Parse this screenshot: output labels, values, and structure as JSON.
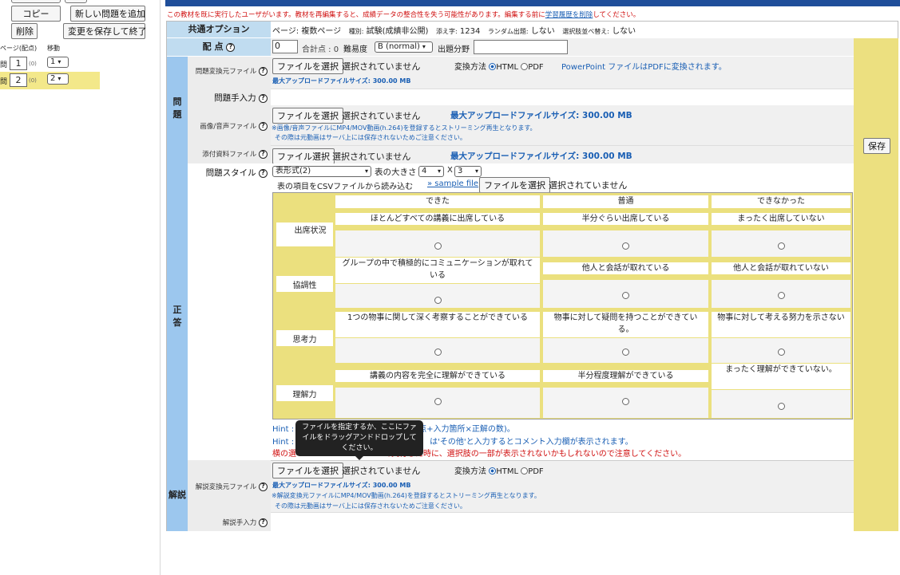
{
  "sidebar": {
    "copy_label": "コピー",
    "add_label": "新しい問題を追加",
    "delete_label": "削除",
    "save_exit_label": "変更を保存して終了",
    "col_page": "ページ(配点)",
    "col_move": "移動",
    "questions": [
      {
        "prefix": "問",
        "num": "1",
        "score": "(0)",
        "move": "1"
      },
      {
        "prefix": "問",
        "num": "2",
        "score": "(0)",
        "move": "2"
      }
    ]
  },
  "warning": {
    "text": "この教材を既に実行したユーザがいます。教材を再編集すると、成績データの整合性を失う可能性があります。編集する前に",
    "link": "学習履歴を削除",
    "after": "してください。"
  },
  "common": {
    "header": "共通オプション",
    "page_label": "ページ:",
    "page_value": "複数ページ",
    "kind_label": "種別:",
    "kind_value": "試験(成績非公開)",
    "chars_label": "添え字:",
    "chars_value": "1234",
    "random_label": "ランダム出題:",
    "random_value": "しない",
    "shuffle_label": "選択肢並べ替え:",
    "shuffle_value": "しない"
  },
  "score_row": {
    "label": "配 点",
    "value": "0",
    "total": "合計点 : 0",
    "difficulty_label": "難易度",
    "difficulty_value": "B (normal)",
    "field_label": "出題分野"
  },
  "question": {
    "section": [
      "問",
      "題"
    ],
    "convert_label": "問題変換元ファイル",
    "file_btn": "ファイルを選択",
    "no_file": "選択されていません",
    "method_label": "変換方法",
    "html": "HTML",
    "pdf": "PDF",
    "ppt_note": "PowerPoint ファイルはPDFに変換されます。",
    "max_upload": "最大アップロードファイルサイズ: 300.00 MB",
    "manual_label": "問題手入力",
    "media_label": "画像/音声ファイル",
    "media_max": "最大アップロードファイルサイズ: 300.00 MB",
    "media_note1": "※画像/音声ファイルにMP4/MOV動画(h.264)を登録するとストリーミング再生となります。",
    "media_note2": "その際は元動画はサーバ上には保存されないためご注意ください。",
    "attach_label": "添付資料ファイル",
    "attach_btn": "ファイル選択",
    "attach_max": "最大アップロードファイルサイズ: 300.00 MB"
  },
  "answer": {
    "section": [
      "正",
      "答"
    ],
    "style_label": "問題スタイル",
    "style_value": "表形式(2)",
    "size_label": "表の大きさ",
    "size_rows": "4",
    "size_x": "X",
    "size_cols": "3",
    "csv_label": "表の項目をCSVファイルから読み込む",
    "sample_link": "» sample file",
    "file_btn": "ファイルを選択",
    "no_file": "選択されていません",
    "grid": {
      "columns": [
        "できた",
        "普通",
        "できなかった"
      ],
      "rows": [
        {
          "label": "出席状況",
          "cells": [
            "ほとんどすべての講義に出席している",
            "半分ぐらい出席している",
            "まったく出席していない"
          ]
        },
        {
          "label": "協調性",
          "cells": [
            "グループの中で積極的にコミュニケーションが取れている",
            "他人と会話が取れている",
            "他人と会話が取れていない"
          ]
        },
        {
          "label": "思考力",
          "cells": [
            "1つの物事に関して深く考察することができている",
            "物事に対して疑問を持つことができている。",
            "物事に対して考える努力を示さない"
          ]
        },
        {
          "label": "理解力",
          "cells": [
            "講義の内容を完全に理解ができている",
            "半分程度理解ができている",
            "まったく理解ができていない。"
          ]
        }
      ]
    },
    "hint1_prefix": "Hint :",
    "hint1_text": "配点+入力箇所×正解の数)。",
    "hint2_prefix": "Hint :",
    "hint2_text": "は'その他'と入力するとコメント入力欄が表示されます。",
    "warn_text": "横の選",
    "warn_text2": "で実行した時に、選択肢の一部が表示されないかもしれないので注意してください。"
  },
  "explain": {
    "section": "解説",
    "convert_label": "解説変換元ファイル",
    "file_btn": "ファイルを選択",
    "no_file": "選択されていません",
    "method_label": "変換方法",
    "html": "HTML",
    "pdf": "PDF",
    "max_upload": "最大アップロードファイルサイズ: 300.00 MB",
    "note1": "※解説変換元ファイルにMP4/MOV動画(h.264)を登録するとストリーミング再生となります。",
    "note2": "その際は元動画はサーバ上には保存されないためご注意ください。",
    "manual_label": "解説手入力"
  },
  "save_label": "保存",
  "tooltip": "ファイルを指定するか、ここにファイルをドラッグアンドドロップしてください。",
  "colors": {
    "accent": "#1f4e9a",
    "section": "#9cc7ee",
    "save_col": "#ece080",
    "warning": "#d01010"
  }
}
